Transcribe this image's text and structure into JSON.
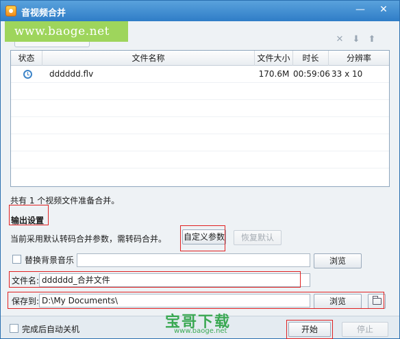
{
  "window": {
    "title": "音视频合并",
    "minimize": "—",
    "close": "✕"
  },
  "watermark": {
    "url": "www.baoge.net",
    "brand": "宝哥下载",
    "brand_url": "www.baoge.net"
  },
  "toolbar": {
    "delete_icon": "✕",
    "down_icon": "⬇",
    "up_icon": "⬆"
  },
  "table": {
    "headers": [
      "状态",
      "文件名称",
      "文件大小",
      "时长",
      "分辨率"
    ],
    "rows": [
      {
        "status_icon": "clock-icon",
        "name": "dddddd.flv",
        "size": "170.6M",
        "duration": "00:59:06",
        "resolution": "33 x 10"
      }
    ]
  },
  "summary": "共有 1 个视频文件准备合并。",
  "output": {
    "title": "输出设置",
    "description": "当前采用默认转码合并参数，需转码合并。",
    "custom_button": "自定义参数",
    "restore_button": "恢复默认",
    "music_label": "替换背景音乐",
    "music_value": "",
    "browse_label": "浏览",
    "filename_label": "文件名:",
    "filename_value": "dddddd_合并文件",
    "save_label": "保存到:",
    "save_value": "D:\\My Documents\\"
  },
  "footer": {
    "shutdown_label": "完成后自动关机",
    "start_button": "开始",
    "stop_button": "停止"
  },
  "colors": {
    "title_bar": "#2f7dc7",
    "highlight": "#e02020",
    "watermark": "#9ed55c",
    "brand": "#3aa852"
  }
}
